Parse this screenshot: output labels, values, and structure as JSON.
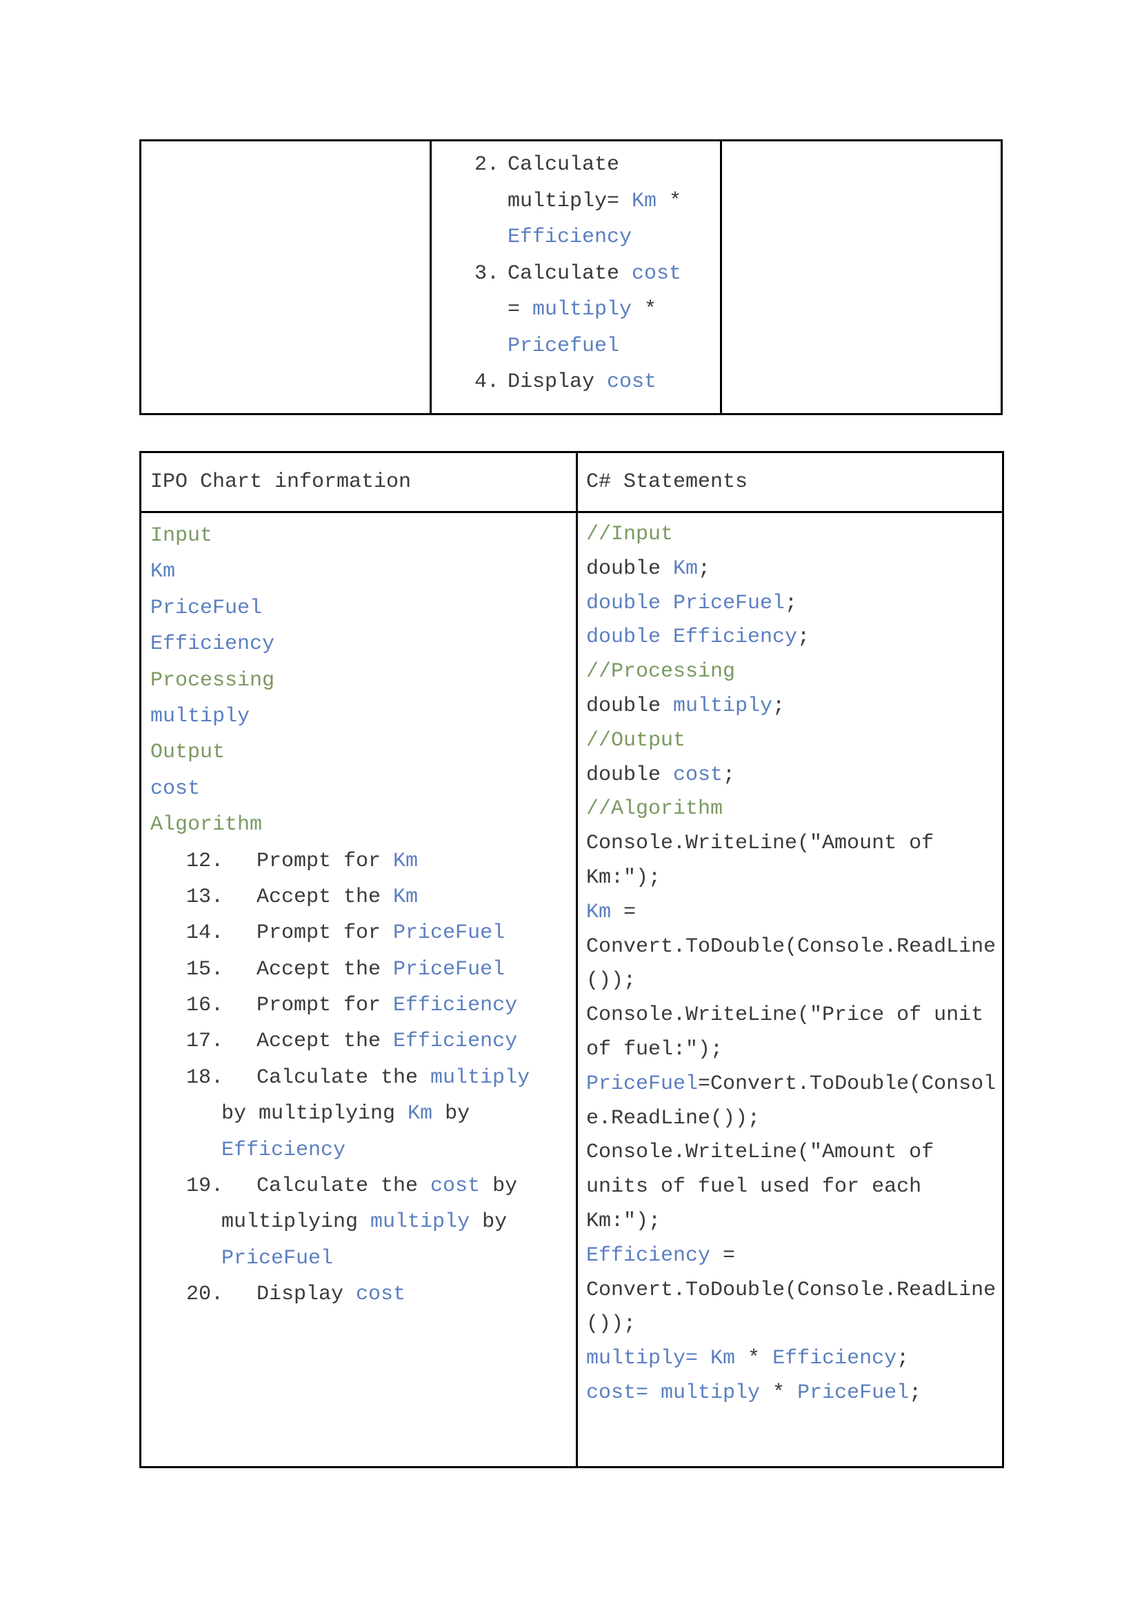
{
  "table1": {
    "steps": [
      {
        "num": "2.",
        "lines": [
          [
            {
              "t": "Calculate",
              "c": "dark"
            }
          ],
          [
            {
              "t": "multiply= ",
              "c": "dark"
            },
            {
              "t": "Km",
              "c": "blue"
            },
            {
              "t": " *",
              "c": "dark"
            }
          ],
          [
            {
              "t": "Efficiency",
              "c": "blue"
            }
          ]
        ]
      },
      {
        "num": "3.",
        "lines": [
          [
            {
              "t": "Calculate ",
              "c": "dark"
            },
            {
              "t": "cost",
              "c": "blue"
            }
          ],
          [
            {
              "t": "= ",
              "c": "dark"
            },
            {
              "t": "multiply",
              "c": "blue"
            },
            {
              "t": " *",
              "c": "dark"
            }
          ],
          [
            {
              "t": "Pricefuel",
              "c": "blue"
            }
          ]
        ]
      },
      {
        "num": "4.",
        "lines": [
          [
            {
              "t": "Display ",
              "c": "dark"
            },
            {
              "t": "cost",
              "c": "blue"
            }
          ]
        ]
      }
    ]
  },
  "table2": {
    "headers": {
      "left": "IPO Chart information",
      "right": "C# Statements"
    },
    "ipo_items": [
      {
        "t": "Input",
        "c": "green"
      },
      {
        "t": "Km",
        "c": "blue"
      },
      {
        "t": "PriceFuel",
        "c": "blue"
      },
      {
        "t": "Efficiency",
        "c": "blue"
      },
      {
        "t": "Processing",
        "c": "green"
      },
      {
        "t": "multiply",
        "c": "blue"
      },
      {
        "t": "Output",
        "c": "green"
      },
      {
        "t": "cost",
        "c": "blue"
      },
      {
        "t": "Algorithm",
        "c": "green"
      }
    ],
    "algorithm_steps": [
      {
        "num": "12.",
        "lines": [
          [
            {
              "t": "Prompt for ",
              "c": "dark"
            },
            {
              "t": "Km",
              "c": "blue"
            }
          ]
        ]
      },
      {
        "num": "13.",
        "lines": [
          [
            {
              "t": "Accept the ",
              "c": "dark"
            },
            {
              "t": "Km",
              "c": "blue"
            }
          ]
        ]
      },
      {
        "num": "14.",
        "lines": [
          [
            {
              "t": "Prompt for ",
              "c": "dark"
            },
            {
              "t": "PriceFuel",
              "c": "blue"
            }
          ]
        ]
      },
      {
        "num": "15.",
        "lines": [
          [
            {
              "t": "Accept the ",
              "c": "dark"
            },
            {
              "t": "PriceFuel",
              "c": "blue"
            }
          ]
        ]
      },
      {
        "num": "16.",
        "lines": [
          [
            {
              "t": "Prompt for ",
              "c": "dark"
            },
            {
              "t": "Efficiency",
              "c": "blue"
            }
          ]
        ]
      },
      {
        "num": "17.",
        "lines": [
          [
            {
              "t": "Accept the ",
              "c": "dark"
            },
            {
              "t": "Efficiency",
              "c": "blue"
            }
          ]
        ]
      },
      {
        "num": "18.",
        "lines": [
          [
            {
              "t": "Calculate the ",
              "c": "dark"
            },
            {
              "t": "multiply",
              "c": "blue"
            }
          ],
          [
            {
              "t": "by multiplying ",
              "c": "dark"
            },
            {
              "t": "Km",
              "c": "blue"
            },
            {
              "t": " by",
              "c": "dark"
            }
          ],
          [
            {
              "t": "Efficiency",
              "c": "blue"
            }
          ]
        ]
      },
      {
        "num": "19.",
        "lines": [
          [
            {
              "t": "Calculate the ",
              "c": "dark"
            },
            {
              "t": "cost",
              "c": "blue"
            },
            {
              "t": " by",
              "c": "dark"
            }
          ],
          [
            {
              "t": "multiplying ",
              "c": "dark"
            },
            {
              "t": "multiply",
              "c": "blue"
            },
            {
              "t": " by",
              "c": "dark"
            }
          ],
          [
            {
              "t": "PriceFuel",
              "c": "blue"
            }
          ]
        ]
      },
      {
        "num": "20.",
        "lines": [
          [
            {
              "t": "Display ",
              "c": "dark"
            },
            {
              "t": "cost",
              "c": "blue"
            }
          ]
        ]
      }
    ],
    "csharp_lines": [
      [
        {
          "t": "//Input",
          "c": "green"
        }
      ],
      [
        {
          "t": "double ",
          "c": "dark"
        },
        {
          "t": "Km",
          "c": "blue"
        },
        {
          "t": ";",
          "c": "dark"
        }
      ],
      [
        {
          "t": "double PriceFuel",
          "c": "blue"
        },
        {
          "t": ";",
          "c": "dark"
        }
      ],
      [
        {
          "t": "double Efficiency",
          "c": "blue"
        },
        {
          "t": ";",
          "c": "dark"
        }
      ],
      [
        {
          "t": "//Processing",
          "c": "green"
        }
      ],
      [
        {
          "t": "double ",
          "c": "dark"
        },
        {
          "t": "multiply",
          "c": "blue"
        },
        {
          "t": ";",
          "c": "dark"
        }
      ],
      [
        {
          "t": "//Output",
          "c": "green"
        }
      ],
      [
        {
          "t": "double ",
          "c": "dark"
        },
        {
          "t": "cost",
          "c": "blue"
        },
        {
          "t": ";",
          "c": "dark"
        }
      ],
      [
        {
          "t": "//Algorithm",
          "c": "green"
        }
      ],
      [
        {
          "t": "Console.WriteLine(\"Amount of",
          "c": "dark"
        }
      ],
      [
        {
          "t": "Km:\");",
          "c": "dark"
        }
      ],
      [
        {
          "t": "Km",
          "c": "blue"
        },
        {
          "t": " =",
          "c": "dark"
        }
      ],
      [
        {
          "t": "Convert.ToDouble(Console.ReadLine",
          "c": "dark"
        }
      ],
      [
        {
          "t": "());",
          "c": "dark"
        }
      ],
      [
        {
          "t": "Console.WriteLine(\"Price of unit",
          "c": "dark"
        }
      ],
      [
        {
          "t": "of fuel:\");",
          "c": "dark"
        }
      ],
      [
        {
          "t": "PriceFuel",
          "c": "blue"
        },
        {
          "t": "=Convert.ToDouble(Consol",
          "c": "dark"
        }
      ],
      [
        {
          "t": "e.ReadLine());",
          "c": "dark"
        }
      ],
      [
        {
          "t": "Console.WriteLine(\"Amount of",
          "c": "dark"
        }
      ],
      [
        {
          "t": "units of fuel used for each",
          "c": "dark"
        }
      ],
      [
        {
          "t": "Km:\");",
          "c": "dark"
        }
      ],
      [
        {
          "t": "Efficiency",
          "c": "blue"
        },
        {
          "t": " =",
          "c": "dark"
        }
      ],
      [
        {
          "t": "Convert.ToDouble(Console.ReadLine",
          "c": "dark"
        }
      ],
      [
        {
          "t": "());",
          "c": "dark"
        }
      ],
      [
        {
          "t": "multiply= Km",
          "c": "blue"
        },
        {
          "t": " * ",
          "c": "dark"
        },
        {
          "t": "Efficiency",
          "c": "blue"
        },
        {
          "t": ";",
          "c": "dark"
        }
      ],
      [
        {
          "t": "cost= multiply",
          "c": "blue"
        },
        {
          "t": " * ",
          "c": "dark"
        },
        {
          "t": "PriceFuel",
          "c": "blue"
        },
        {
          "t": ";",
          "c": "dark"
        }
      ]
    ]
  }
}
